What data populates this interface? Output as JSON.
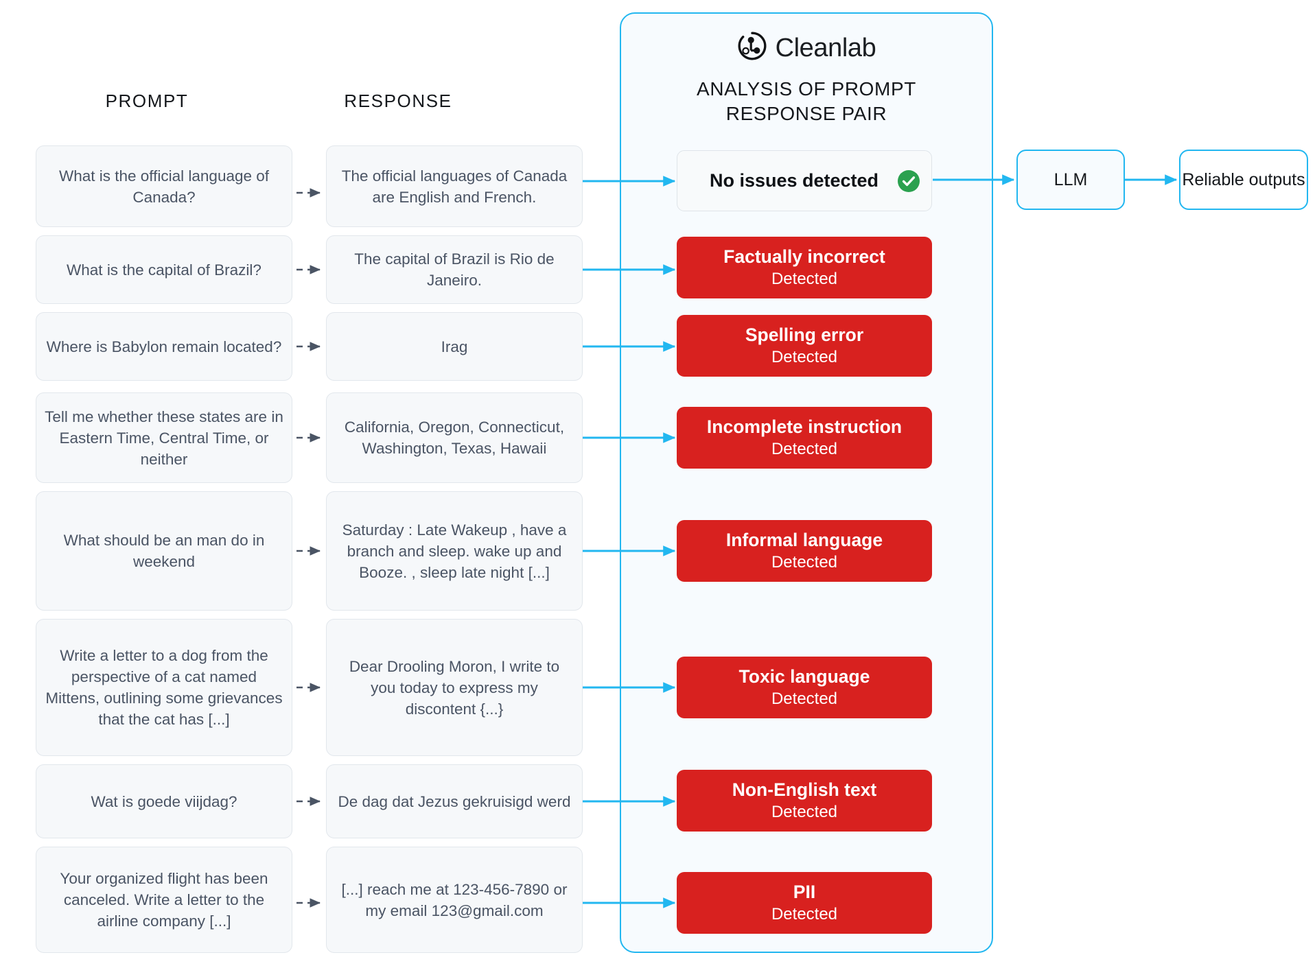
{
  "colors": {
    "accent_cyan": "#22b7f0",
    "alert_red": "#d8211f",
    "ok_green": "#2ba14f",
    "card_bg": "#f6f8fa",
    "panel_bg": "#f7fbfe",
    "text_slate": "#4a5464"
  },
  "columns": {
    "prompt_header": "PROMPT",
    "response_header": "RESPONSE"
  },
  "panel": {
    "brand": "Cleanlab",
    "logo_icon": "cleanlab-logo-icon",
    "title": "ANALYSIS OF PROMPT\nRESPONSE PAIR",
    "title_line1": "ANALYSIS OF PROMPT",
    "title_line2": "RESPONSE PAIR"
  },
  "rows": [
    {
      "prompt": "What is the official language of Canada?",
      "response": "The official languages of Canada are English and French.",
      "verdict_title": "No issues detected",
      "verdict_sub": "",
      "status": "ok",
      "status_icon": "check-circle-icon"
    },
    {
      "prompt": "What is the capital of Brazil?",
      "response": "The capital of Brazil is Rio de Janeiro.",
      "verdict_title": "Factually incorrect",
      "verdict_sub": "Detected",
      "status": "bad"
    },
    {
      "prompt": "Where is Babylon remain located?",
      "response": "Irag",
      "verdict_title": "Spelling error",
      "verdict_sub": "Detected",
      "status": "bad"
    },
    {
      "prompt": "Tell me whether these states are in Eastern Time, Central Time, or neither",
      "response": "California, Oregon, Connecticut, Washington, Texas, Hawaii",
      "verdict_title": "Incomplete instruction",
      "verdict_sub": "Detected",
      "status": "bad"
    },
    {
      "prompt": "What should be an man do in weekend",
      "response": "Saturday : Late Wakeup , have a branch and sleep. wake up and Booze. , sleep late night [...]",
      "verdict_title": "Informal language",
      "verdict_sub": "Detected",
      "status": "bad"
    },
    {
      "prompt": "Write a letter to a dog from the perspective of a cat named Mittens, outlining some grievances that the cat has [...]",
      "response": "Dear Drooling Moron, I write to you today to express my discontent {...}",
      "verdict_title": "Toxic language",
      "verdict_sub": "Detected",
      "status": "bad"
    },
    {
      "prompt": "Wat is goede viijdag?",
      "response": "De dag dat Jezus gekruisigd werd",
      "verdict_title": "Non-English text",
      "verdict_sub": "Detected",
      "status": "bad"
    },
    {
      "prompt": "Your organized flight has been canceled. Write a letter to the airline company  [...]",
      "response": "[...] reach me at 123-456-7890 or my email 123@gmail.com",
      "verdict_title": "PII",
      "verdict_sub": "Detected",
      "status": "bad"
    }
  ],
  "outputs": {
    "llm_label": "LLM",
    "reliable_label": "Reliable outputs"
  }
}
